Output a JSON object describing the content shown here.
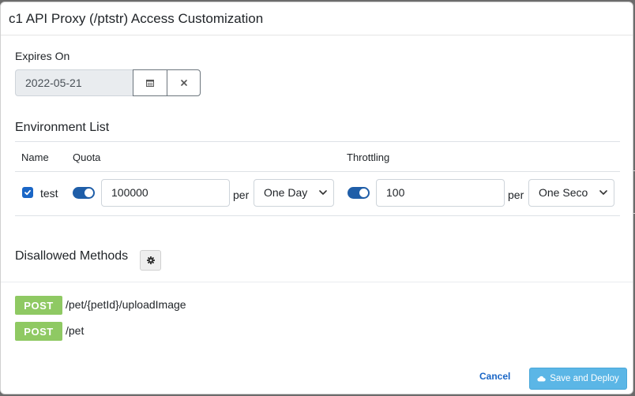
{
  "modal": {
    "title": "c1 API Proxy (/ptstr) Access Customization"
  },
  "expires": {
    "label": "Expires On",
    "value": "2022-05-21",
    "calendar_icon": "calendar-icon",
    "clear_icon": "close-icon"
  },
  "environment": {
    "title": "Environment List",
    "headers": {
      "name": "Name",
      "quota": "Quota",
      "throttling": "Throttling"
    },
    "rows": [
      {
        "checked": true,
        "name": "test",
        "quota_enabled": true,
        "quota_value": "100000",
        "quota_per_label": "per",
        "quota_period": "One Day",
        "throttling_enabled": true,
        "throttling_value": "100",
        "throttling_per_label": "per",
        "throttling_period": "One Seco"
      }
    ]
  },
  "disallowed": {
    "title": "Disallowed Methods",
    "settings_icon": "gear-icon",
    "methods": [
      {
        "method": "POST",
        "path": "/pet/{petId}/uploadImage"
      },
      {
        "method": "POST",
        "path": "/pet"
      }
    ]
  },
  "footer": {
    "cancel_label": "Cancel",
    "deploy_label": "Save and Deploy",
    "deploy_icon": "cloud-icon"
  },
  "colors": {
    "primary": "#1a66c6",
    "method_post": "#8fc963",
    "deploy_button": "#5bb6e6"
  }
}
